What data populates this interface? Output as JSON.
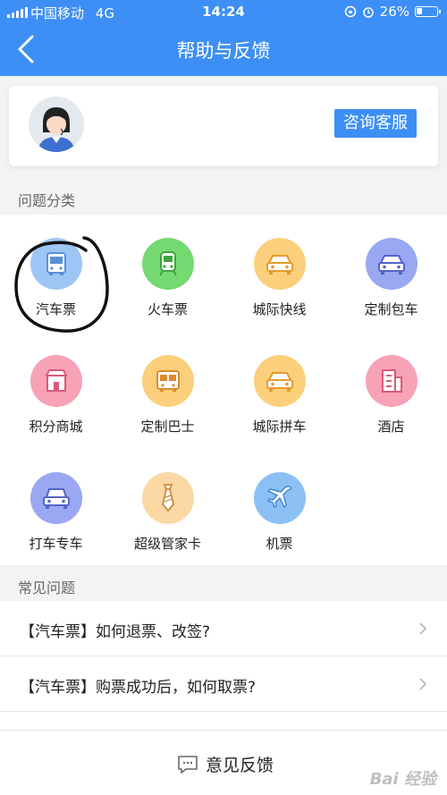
{
  "status_bar": {
    "carrier": "中国移动",
    "network": "4G",
    "time": "14:24",
    "battery": "26%"
  },
  "nav": {
    "title": "帮助与反馈"
  },
  "service": {
    "consult_label": "咨询客服"
  },
  "categories": {
    "heading": "问题分类",
    "items": [
      {
        "label": "汽车票",
        "icon": "bus-icon",
        "color": "#9ec6f5"
      },
      {
        "label": "火车票",
        "icon": "train-icon",
        "color": "#74d970"
      },
      {
        "label": "城际快线",
        "icon": "car-icon",
        "color": "#fbcf7b"
      },
      {
        "label": "定制包车",
        "icon": "car-icon",
        "color": "#9aa7f2"
      },
      {
        "label": "积分商城",
        "icon": "shop-icon",
        "color": "#f7a2b5"
      },
      {
        "label": "定制巴士",
        "icon": "bus-icon",
        "color": "#fbcf7b"
      },
      {
        "label": "城际拼车",
        "icon": "car-icon",
        "color": "#fbcf7b"
      },
      {
        "label": "酒店",
        "icon": "hotel-icon",
        "color": "#f7a2b5"
      },
      {
        "label": "打车专车",
        "icon": "taxi-icon",
        "color": "#9aa7f2"
      },
      {
        "label": "超级管家卡",
        "icon": "tie-icon",
        "color": "#fbd8a4"
      },
      {
        "label": "机票",
        "icon": "plane-icon",
        "color": "#8cc0f5"
      }
    ]
  },
  "faq": {
    "heading": "常见问题",
    "items": [
      {
        "text": "【汽车票】如何退票、改签?"
      },
      {
        "text": "【汽车票】购票成功后，如何取票?"
      }
    ]
  },
  "feedback": {
    "label": "意见反馈"
  },
  "watermark": "Bai 经验"
}
